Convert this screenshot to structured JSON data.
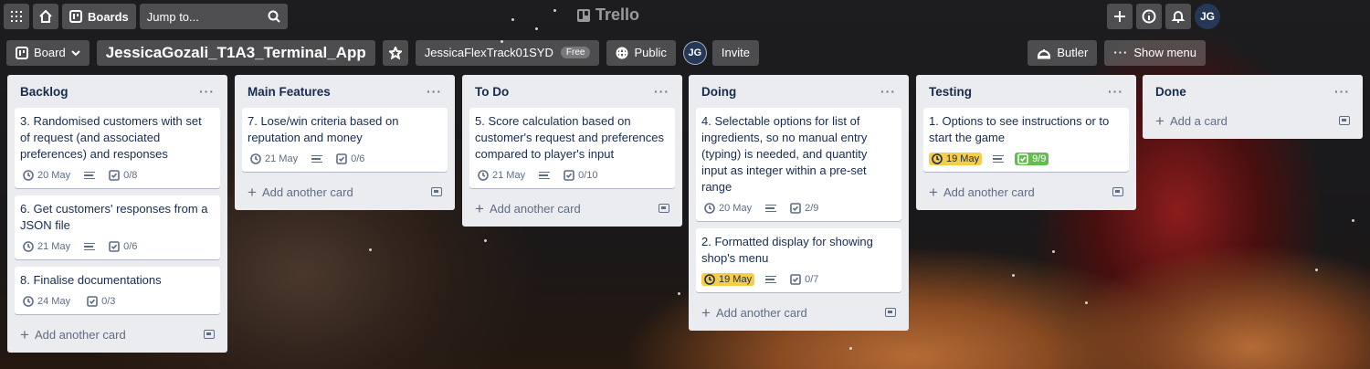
{
  "nav": {
    "boards_label": "Boards",
    "search_placeholder": "Jump to...",
    "logo_text": "Trello",
    "avatar_initials": "JG"
  },
  "board": {
    "view_label": "Board",
    "title": "JessicaGozali_T1A3_Terminal_App",
    "workspace": "JessicaFlexTrack01SYD",
    "workspace_plan": "Free",
    "visibility": "Public",
    "member_initials": "JG",
    "invite_label": "Invite",
    "butler_label": "Butler",
    "show_menu_label": "Show menu"
  },
  "lists": [
    {
      "title": "Backlog",
      "add_label": "Add another card",
      "cards": [
        {
          "title": "3. Randomised customers with set of request (and associated preferences) and responses",
          "due": "20 May",
          "due_style": "plain",
          "description": true,
          "checklist": "0/8",
          "checklist_style": "plain"
        },
        {
          "title": "6. Get customers' responses from a JSON file",
          "due": "21 May",
          "due_style": "plain",
          "description": true,
          "checklist": "0/6",
          "checklist_style": "plain"
        },
        {
          "title": "8. Finalise documentations",
          "due": "24 May",
          "due_style": "plain",
          "description": false,
          "checklist": "0/3",
          "checklist_style": "plain"
        }
      ]
    },
    {
      "title": "Main Features",
      "add_label": "Add another card",
      "cards": [
        {
          "title": "7. Lose/win criteria based on reputation and money",
          "due": "21 May",
          "due_style": "plain",
          "description": true,
          "checklist": "0/6",
          "checklist_style": "plain"
        }
      ]
    },
    {
      "title": "To Do",
      "add_label": "Add another card",
      "cards": [
        {
          "title": "5. Score calculation based on customer's request and preferences compared to player's input",
          "due": "21 May",
          "due_style": "plain",
          "description": true,
          "checklist": "0/10",
          "checklist_style": "plain"
        }
      ]
    },
    {
      "title": "Doing",
      "add_label": "Add another card",
      "cards": [
        {
          "title": "4. Selectable options for list of ingredients, so no manual entry (typing) is needed, and quantity input as integer within a pre-set range",
          "due": "20 May",
          "due_style": "plain",
          "description": true,
          "checklist": "2/9",
          "checklist_style": "plain"
        },
        {
          "title": "2. Formatted display for showing shop's menu",
          "due": "19 May",
          "due_style": "due-soon",
          "description": true,
          "checklist": "0/7",
          "checklist_style": "plain"
        }
      ]
    },
    {
      "title": "Testing",
      "add_label": "Add another card",
      "cards": [
        {
          "title": "1. Options to see instructions or to start the game",
          "due": "19 May",
          "due_style": "due-soon",
          "description": true,
          "checklist": "9/9",
          "checklist_style": "complete"
        }
      ]
    },
    {
      "title": "Done",
      "add_label": "Add a card",
      "cards": []
    }
  ],
  "colors": {
    "due_soon": "#f5cd47",
    "checklist_complete": "#61bd4f",
    "list_bg": "#ebecf0"
  }
}
